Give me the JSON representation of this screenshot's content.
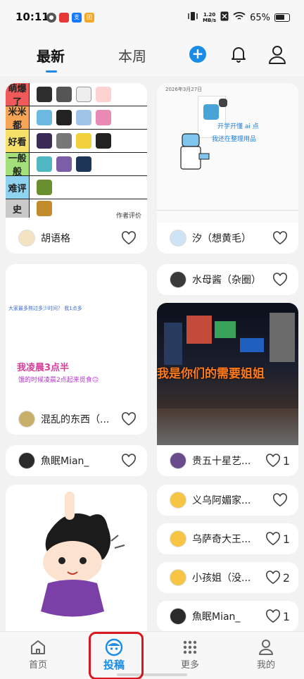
{
  "status_bar": {
    "time": "10:11",
    "net_speed": "1.20",
    "net_unit": "MB/s",
    "battery": "65%"
  },
  "header": {
    "tabs": [
      {
        "label": "最新",
        "active": true
      },
      {
        "label": "本周",
        "active": false
      }
    ],
    "add_icon": "plus-circle-icon",
    "notify_icon": "bell-icon",
    "profile_icon": "person-icon",
    "accent": "#1a8ce8"
  },
  "feed": {
    "left": [
      {
        "type": "tier_list",
        "tiers": [
          "萌爆了",
          "米米都",
          "好看",
          "一般般",
          "难评",
          "史"
        ],
        "signature": "作者评价",
        "user": "胡语格",
        "likes": ""
      },
      {
        "type": "text_post",
        "line1": "大家最多熬过多少时间？ 我1点多",
        "line2": "我凌晨3点半",
        "line3": "饿的时候凌晨2点起来觅食🙃",
        "user": "混乱的东西（...",
        "likes": ""
      },
      {
        "type": "user_only",
        "user": "魚眠Mian_",
        "likes": ""
      },
      {
        "type": "sticker",
        "user": "",
        "likes": ""
      }
    ],
    "right": [
      {
        "type": "screenshot",
        "header_text": "2026年3月27日",
        "caption1": "开学开懂 ai 点",
        "caption2": "我还在整理用品",
        "user": "汐（想黄毛）",
        "likes": ""
      },
      {
        "type": "user_only",
        "user": "水母酱（杂圈）",
        "likes": ""
      },
      {
        "type": "photo",
        "caption": "我是你们的需要姐姐",
        "user": "贵五十星艺...",
        "likes": "1"
      },
      {
        "type": "user_only",
        "user": "义乌阿媚家...",
        "likes": ""
      },
      {
        "type": "user_only",
        "user": "乌萨奇大王...",
        "likes": "1"
      },
      {
        "type": "user_only",
        "user": "小孩姐（没...",
        "likes": "2"
      },
      {
        "type": "user_only",
        "user": "魚眠Mian_",
        "likes": "1"
      }
    ]
  },
  "bottom_nav": {
    "items": [
      {
        "label": "首页",
        "icon": "home-icon",
        "active": false
      },
      {
        "label": "投稿",
        "icon": "face-icon",
        "active": true
      },
      {
        "label": "更多",
        "icon": "grid-dots-icon",
        "active": false
      },
      {
        "label": "我的",
        "icon": "person-icon",
        "active": false
      }
    ]
  },
  "highlight_color": "#d8171e"
}
